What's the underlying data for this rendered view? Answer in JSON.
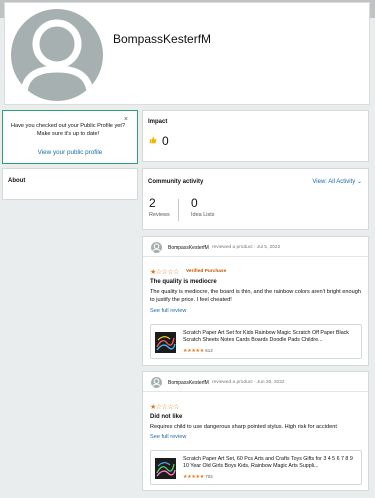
{
  "profile": {
    "name": "BompassKesterfM"
  },
  "public_profile_prompt": {
    "text": "Have you checked out your Public Profile yet? Make sure it's up to date!",
    "close": "×",
    "link": "View your public profile"
  },
  "about": {
    "title": "About"
  },
  "impact": {
    "title": "Impact",
    "count": "0",
    "icon": "helpful-vote-icon"
  },
  "community": {
    "title": "Community activity",
    "view_label": "View: All Activity ⌄",
    "stats": [
      {
        "value": "2",
        "label": "Reviews"
      },
      {
        "value": "0",
        "label": "Idea Lists"
      }
    ]
  },
  "reviews": [
    {
      "author": "BompassKesterfM",
      "meta": "reviewed a product · Jul 5, 2022",
      "stars": "★☆☆☆☆",
      "rating": 1,
      "verified": "Verified Purchase",
      "title": "The quality is mediocre",
      "body": "The quality is mediocre, the board is thin, and the rainbow colors aren't bright enough to justify the price. I feel cheated!",
      "see_more": "See full review",
      "product": {
        "title": "Scratch Paper Art Set for Kids Rainbow Magic Scratch Off Paper Black Scratch Sheets Notes Cards Boards Doodle Pads Childre...",
        "stars": "★★★★★",
        "rating_count": "614"
      }
    },
    {
      "author": "BompassKesterfM",
      "meta": "reviewed a product · Jun 26, 2022",
      "stars": "★☆☆☆☆",
      "rating": 1,
      "verified": "",
      "title": "Did not like",
      "body": "Requires child to use dangerous sharp pointed stylus. High risk for accident",
      "see_more": "See full review",
      "product": {
        "title": "Scratch Paper Art Set, 60 Pcs Arts and Crafts Toys Gifts for 3 4 5 6 7 8 9 10 Year Old Girls Boys Kids, Rainbow Magic Arts Suppli...",
        "stars": "★★★★★",
        "rating_count": "702"
      }
    }
  ],
  "colors": {
    "accent_green": "#2f9e72",
    "link_blue": "#1b6ca8",
    "star_orange": "#de7921",
    "avatar_gray": "#a7b0b0"
  }
}
